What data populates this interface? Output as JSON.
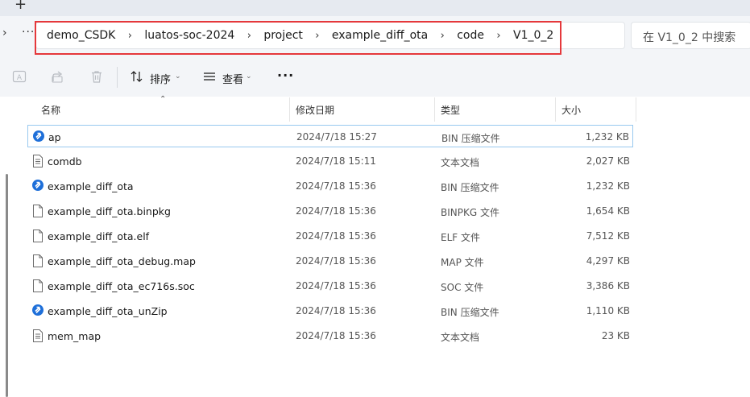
{
  "tabstrip": {
    "new_tab_glyph": "+"
  },
  "address_bar": {
    "nav_chevron": "›",
    "overflow": "···",
    "breadcrumbs": [
      "demo_CSDK",
      "luatos-soc-2024",
      "project",
      "example_diff_ota",
      "code",
      "V1_0_2"
    ],
    "separator": "›",
    "search_placeholder": "在 V1_0_2 中搜索",
    "highlight_color": "#e5383b"
  },
  "command_bar": {
    "sort_label": "排序",
    "view_label": "查看",
    "more_label": "···",
    "caret": "⌄",
    "icons": [
      "rename-icon",
      "share-icon",
      "delete-icon",
      "sort-icon",
      "view-icon"
    ]
  },
  "file_list": {
    "columns": {
      "name": "名称",
      "modified": "修改日期",
      "type": "类型",
      "size": "大小"
    },
    "sort_indicator": "⌃",
    "files": [
      {
        "name": "ap",
        "modified": "2024/7/18 15:27",
        "type": "BIN 压缩文件",
        "size": "1,232 KB",
        "icon": "bin-archive-icon",
        "selected": true
      },
      {
        "name": "comdb",
        "modified": "2024/7/18 15:11",
        "type": "文本文档",
        "size": "2,027 KB",
        "icon": "text-document-icon",
        "selected": false
      },
      {
        "name": "example_diff_ota",
        "modified": "2024/7/18 15:36",
        "type": "BIN 压缩文件",
        "size": "1,232 KB",
        "icon": "bin-archive-icon",
        "selected": false
      },
      {
        "name": "example_diff_ota.binpkg",
        "modified": "2024/7/18 15:36",
        "type": "BINPKG 文件",
        "size": "1,654 KB",
        "icon": "blank-file-icon",
        "selected": false
      },
      {
        "name": "example_diff_ota.elf",
        "modified": "2024/7/18 15:36",
        "type": "ELF 文件",
        "size": "7,512 KB",
        "icon": "blank-file-icon",
        "selected": false
      },
      {
        "name": "example_diff_ota_debug.map",
        "modified": "2024/7/18 15:36",
        "type": "MAP 文件",
        "size": "4,297 KB",
        "icon": "blank-file-icon",
        "selected": false
      },
      {
        "name": "example_diff_ota_ec716s.soc",
        "modified": "2024/7/18 15:36",
        "type": "SOC 文件",
        "size": "3,386 KB",
        "icon": "blank-file-icon",
        "selected": false
      },
      {
        "name": "example_diff_ota_unZip",
        "modified": "2024/7/18 15:36",
        "type": "BIN 压缩文件",
        "size": "1,110 KB",
        "icon": "bin-archive-icon",
        "selected": false
      },
      {
        "name": "mem_map",
        "modified": "2024/7/18 15:36",
        "type": "文本文档",
        "size": "23 KB",
        "icon": "text-document-icon",
        "selected": false
      }
    ]
  },
  "colors": {
    "accent": "#1e6fd9",
    "selection_border": "#99c9ef",
    "toolbar_bg": "#f3f5f8"
  }
}
